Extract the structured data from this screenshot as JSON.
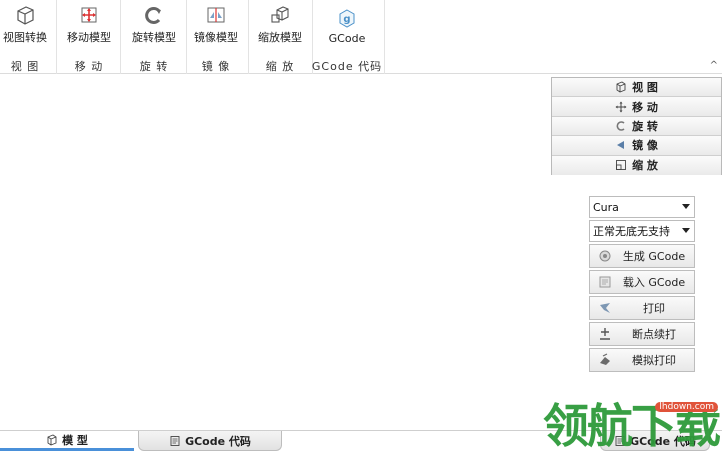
{
  "ribbon": {
    "groups": [
      {
        "button": "视图转换",
        "group": "视 图"
      },
      {
        "button": "移动模型",
        "group": "移 动"
      },
      {
        "button": "旋转模型",
        "group": "旋 转"
      },
      {
        "button": "镜像模型",
        "group": "镜 像"
      },
      {
        "button": "缩放模型",
        "group": "缩 放"
      },
      {
        "button": "GCode",
        "group": "GCode 代码"
      }
    ]
  },
  "view_panel": {
    "items": [
      "视 图",
      "移 动",
      "旋 转",
      "镜 像",
      "缩 放"
    ]
  },
  "right_panel": {
    "slicer": "Cura",
    "support": "正常无底无支持",
    "buttons": [
      "生成 GCode",
      "载入 GCode",
      "打印",
      "断点续打",
      "模拟打印"
    ]
  },
  "tabs": [
    "模 型",
    "GCode 代码",
    "GCode 代码"
  ],
  "watermark": {
    "text": "领航下载",
    "url": "lhdown.com"
  }
}
